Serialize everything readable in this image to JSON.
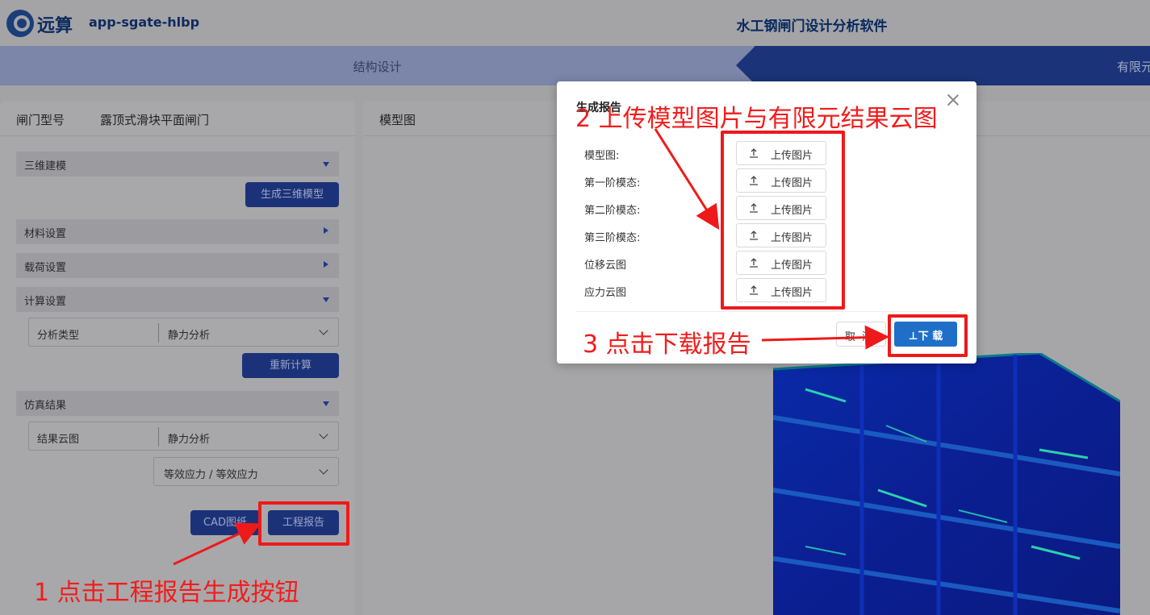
{
  "header": {
    "logo_text": "远算",
    "app_name": "app-sgate-hlbp",
    "title": "水工钢闸门设计分析软件"
  },
  "steps": [
    "结构设计",
    "有限元"
  ],
  "left_panel": {
    "gate_type_label": "闸门型号",
    "gate_type_value": "露顶式滑块平面闸门",
    "sections": {
      "modeling": "三维建模",
      "material": "材料设置",
      "load": "载荷设置",
      "calc": "计算设置",
      "results": "仿真结果"
    },
    "generate_model_button": "生成三维模型",
    "analysis_type_label": "分析类型",
    "analysis_type_value": "静力分析",
    "recalc_button": "重新计算",
    "result_contour_label": "结果云图",
    "result_contour_value": "静力分析",
    "stress_select_value": "等效应力 / 等效应力",
    "cad_button": "CAD图纸",
    "report_button": "工程报告"
  },
  "right_panel": {
    "title": "模型图"
  },
  "modal": {
    "title": "生成报告",
    "rows": [
      {
        "label": "模型图:",
        "button": "上传图片"
      },
      {
        "label": "第一阶模态:",
        "button": "上传图片"
      },
      {
        "label": "第二阶模态:",
        "button": "上传图片"
      },
      {
        "label": "第三阶模态:",
        "button": "上传图片"
      },
      {
        "label": "位移云图",
        "button": "上传图片"
      },
      {
        "label": "应力云图",
        "button": "上传图片"
      }
    ],
    "cancel_button": "取消",
    "download_button": "⊥下 载"
  },
  "annotations": {
    "step1": "1 点击工程报告生成按钮",
    "step2": "2 上传模型图片与有限元结果云图",
    "step3": "3 点击下载报告"
  },
  "colors": {
    "primary_blue": "#1c3278",
    "download_blue": "#1f6fc8",
    "annotation_red": "#ee1a1a"
  }
}
